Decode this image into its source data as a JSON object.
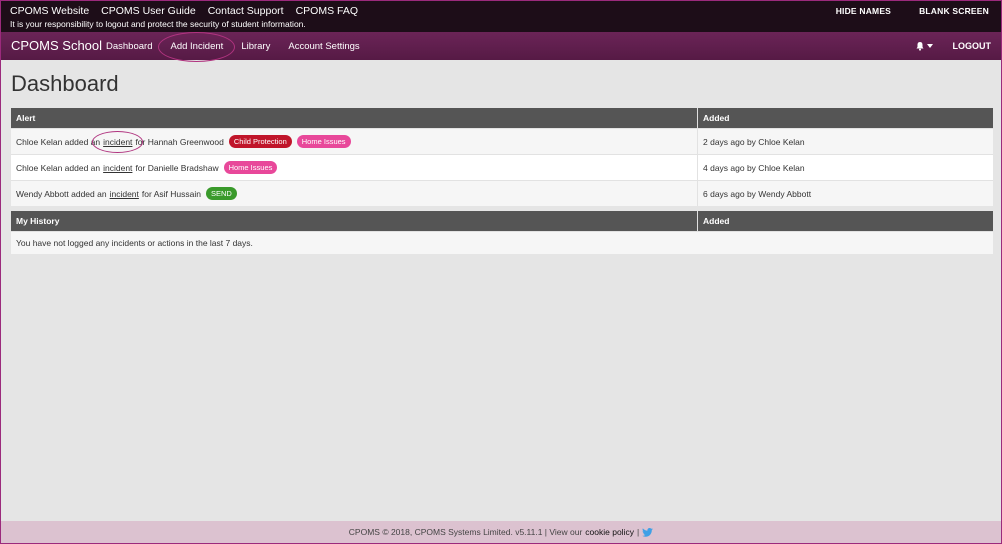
{
  "topbar": {
    "links": [
      "CPOMS Website",
      "CPOMS User Guide",
      "Contact Support",
      "CPOMS FAQ"
    ],
    "notice": "It is your responsibility to logout and protect the security of student information.",
    "hide_names": "HIDE NAMES",
    "blank_screen": "BLANK SCREEN"
  },
  "nav": {
    "brand": "CPOMS School",
    "items": [
      "Dashboard",
      "Add Incident",
      "Library",
      "Account Settings"
    ],
    "logout": "LOGOUT"
  },
  "page": {
    "title": "Dashboard"
  },
  "alerts": {
    "headers": [
      "Alert",
      "Added"
    ],
    "rows": [
      {
        "actor": "Chloe Kelan added an",
        "link": "incident",
        "for": "for Hannah Greenwood",
        "badges": [
          {
            "label": "Child Protection",
            "color": "#c0152a"
          },
          {
            "label": "Home Issues",
            "color": "#e8489a"
          }
        ],
        "added": "2 days ago by Chloe Kelan"
      },
      {
        "actor": "Chloe Kelan added an",
        "link": "incident",
        "for": "for Danielle Bradshaw",
        "badges": [
          {
            "label": "Home Issues",
            "color": "#e8489a"
          }
        ],
        "added": "4 days ago by Chloe Kelan"
      },
      {
        "actor": "Wendy Abbott added an",
        "link": "incident",
        "for": "for Asif Hussain",
        "badges": [
          {
            "label": "SEND",
            "color": "#3a9a2b"
          }
        ],
        "added": "6 days ago by Wendy Abbott"
      }
    ]
  },
  "history": {
    "headers": [
      "My History",
      "Added"
    ],
    "empty": "You have not logged any incidents or actions in the last 7 days."
  },
  "footer": {
    "text": "CPOMS © 2018, CPOMS Systems Limited. v5.11.1 | View our",
    "cookie": "cookie policy",
    "sep": "|"
  },
  "icons": {
    "bell": "bell-icon",
    "twitter": "twitter-icon"
  },
  "colors": {
    "top": "#1d0d18",
    "nav": "#5e1d4c",
    "footer": "#dcc2d0",
    "header": "#555555"
  }
}
